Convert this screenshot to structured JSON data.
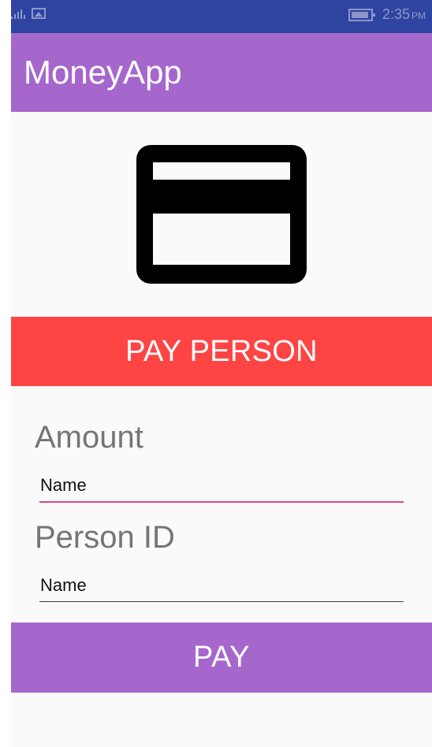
{
  "status_bar": {
    "time": "2:35",
    "am_pm": "PM",
    "icons": [
      "signal-icon",
      "image-icon",
      "battery-icon"
    ]
  },
  "app": {
    "title": "MoneyApp"
  },
  "main": {
    "banner_label": "PAY PERSON",
    "card_icon": "credit-card-icon",
    "amount_label": "Amount",
    "amount_placeholder": "Name",
    "person_id_label": "Person ID",
    "person_id_placeholder": "Name",
    "pay_button_label": "PAY"
  },
  "colors": {
    "status_bar": "#2f43a1",
    "app_bar": "#a667cc",
    "banner": "#ff4444",
    "pay_button": "#a667cc",
    "active_underline": "#e0438c"
  }
}
